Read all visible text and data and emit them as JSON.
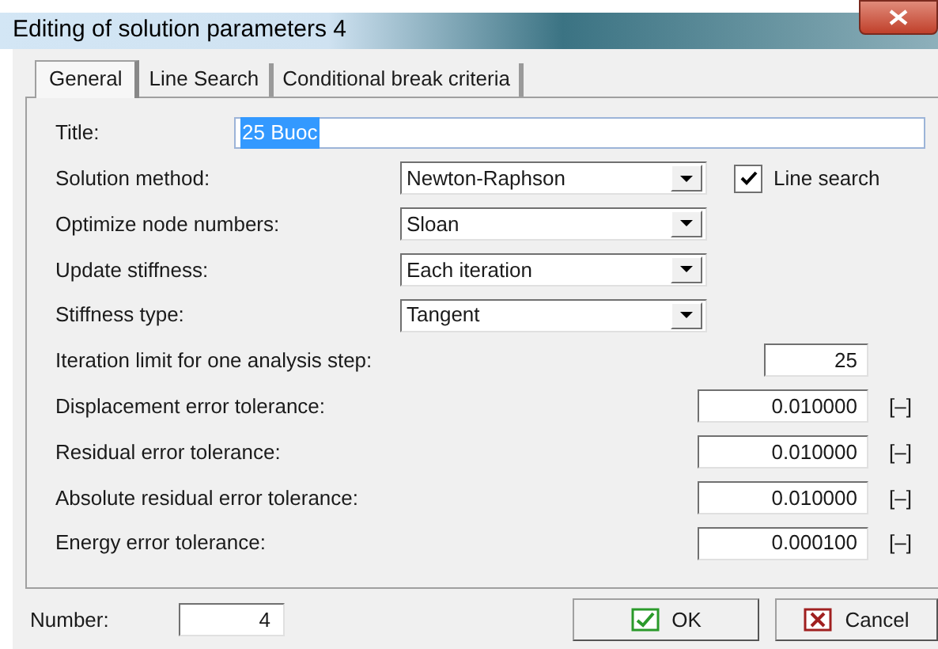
{
  "window": {
    "title": "Editing of solution parameters 4"
  },
  "tabs": [
    {
      "label": "General",
      "selected": true
    },
    {
      "label": "Line Search",
      "selected": false
    },
    {
      "label": "Conditional break criteria",
      "selected": false
    }
  ],
  "fields": [
    {
      "kind": "text",
      "label": "Title:",
      "value": "25 Buoc",
      "highlighted": true
    },
    {
      "kind": "dropdown",
      "label": "Solution method:",
      "value": "Newton-Raphson",
      "checkbox": {
        "label": "Line search",
        "checked": true
      }
    },
    {
      "kind": "dropdown",
      "label": "Optimize node numbers:",
      "value": "Sloan"
    },
    {
      "kind": "dropdown",
      "label": "Update stiffness:",
      "value": "Each iteration"
    },
    {
      "kind": "dropdown",
      "label": "Stiffness type:",
      "value": "Tangent"
    },
    {
      "kind": "number",
      "label": "Iteration limit for one analysis step:",
      "value": "25"
    },
    {
      "kind": "number",
      "label": "Displacement error tolerance:",
      "value": "0.010000",
      "unit": "[–]"
    },
    {
      "kind": "number",
      "label": "Residual error tolerance:",
      "value": "0.010000",
      "unit": "[–]"
    },
    {
      "kind": "number",
      "label": "Absolute residual error tolerance:",
      "value": "0.010000",
      "unit": "[–]"
    },
    {
      "kind": "number",
      "label": "Energy error tolerance:",
      "value": "0.000100",
      "unit": "[–]"
    }
  ],
  "number": {
    "label": "Number:",
    "value": "4"
  },
  "buttons": [
    {
      "kind": "ok",
      "label": "OK"
    },
    {
      "kind": "cancel",
      "label": "Cancel"
    }
  ]
}
